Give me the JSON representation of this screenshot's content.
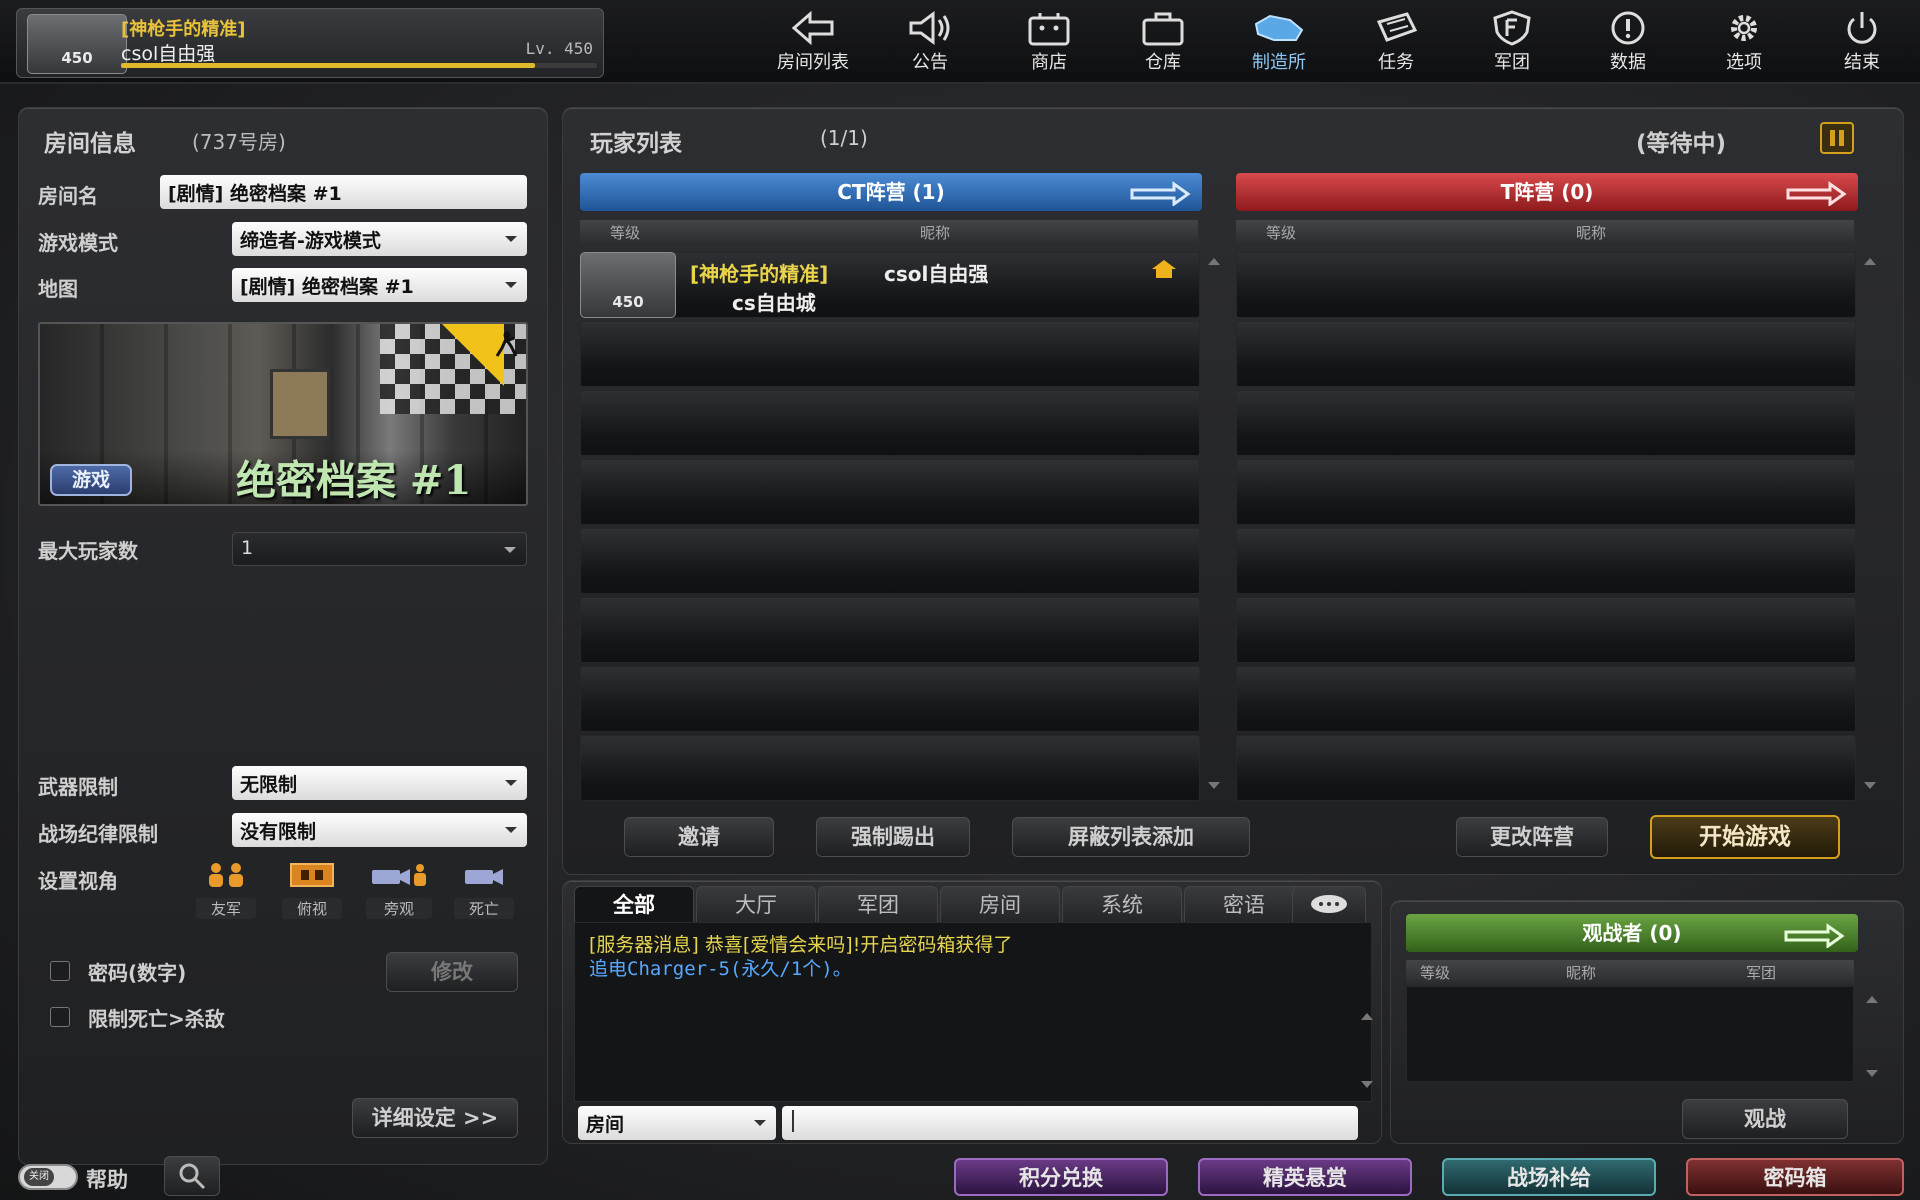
{
  "player": {
    "title": "[神枪手的精准]",
    "name": "csol自由强",
    "level": "Lv. 450",
    "badge": "450",
    "exp_fraction": 0.87
  },
  "nav": [
    {
      "label": "房间列表",
      "icon": "back-arrow-icon"
    },
    {
      "label": "公告",
      "icon": "megaphone-icon"
    },
    {
      "label": "商店",
      "icon": "shop-icon"
    },
    {
      "label": "仓库",
      "icon": "briefcase-icon"
    },
    {
      "label": "制造所",
      "icon": "crafting-icon"
    },
    {
      "label": "任务",
      "icon": "quest-icon"
    },
    {
      "label": "军团",
      "icon": "clan-shield-icon"
    },
    {
      "label": "数据",
      "icon": "alert-icon"
    },
    {
      "label": "选项",
      "icon": "gear-icon"
    },
    {
      "label": "结束",
      "icon": "power-icon"
    }
  ],
  "room": {
    "header": "房间信息",
    "number": "(737号房)",
    "name_label": "房间名",
    "name_value": "[剧情] 绝密档案 #1",
    "mode_label": "游戏模式",
    "mode_value": "缔造者-游戏模式",
    "map_label": "地图",
    "map_value": "[剧情] 绝密档案 #1",
    "map_title": "绝密档案 #1",
    "map_tag": "游戏",
    "max_label": "最大玩家数",
    "max_value": "1",
    "weapon_label": "武器限制",
    "weapon_value": "无限制",
    "discipline_label": "战场纪律限制",
    "discipline_value": "没有限制",
    "view_label": "设置视角",
    "views": [
      "友军",
      "俯视",
      "旁观",
      "死亡"
    ],
    "password_label": "密码(数字)",
    "modify_label": "修改",
    "death_label": "限制死亡>杀敌",
    "detail_label": "详细设定 >>"
  },
  "players": {
    "header": "玩家列表",
    "count": "(1/1)",
    "status": "(等待中)",
    "ct_label": "CT阵营 (1)",
    "t_label": "T阵营 (0)",
    "col_level": "等级",
    "col_name": "昵称",
    "ct_rows": [
      {
        "badge": "450",
        "title": "[神枪手的精准]",
        "name": "csol自由强",
        "clan": "cs自由城"
      }
    ],
    "buttons": {
      "invite": "邀请",
      "kick": "强制踢出",
      "block": "屏蔽列表添加",
      "change": "更改阵营",
      "start": "开始游戏"
    }
  },
  "chat": {
    "tabs": [
      "全部",
      "大厅",
      "军团",
      "房间",
      "系统",
      "密语"
    ],
    "message_prefix": "[服务器消息]",
    "message_text": "恭喜[爱情会来吗]!开启密码箱获得了",
    "message_item": "追电Charger-5(永久/1个)。",
    "channel": "房间",
    "input_value": ""
  },
  "spectators": {
    "header": "观战者 (0)",
    "col_level": "等级",
    "col_name": "昵称",
    "col_clan": "军团",
    "watch_label": "观战"
  },
  "footer": {
    "help_label": "帮助",
    "key_label": "关闭",
    "buttons": [
      "积分兑换",
      "精英悬赏",
      "战场补给",
      "密码箱"
    ]
  },
  "colors": {
    "ct": "#2f6fb8",
    "t": "#b3262a",
    "spec": "#4e8a2e",
    "accent": "#d4a01c"
  }
}
